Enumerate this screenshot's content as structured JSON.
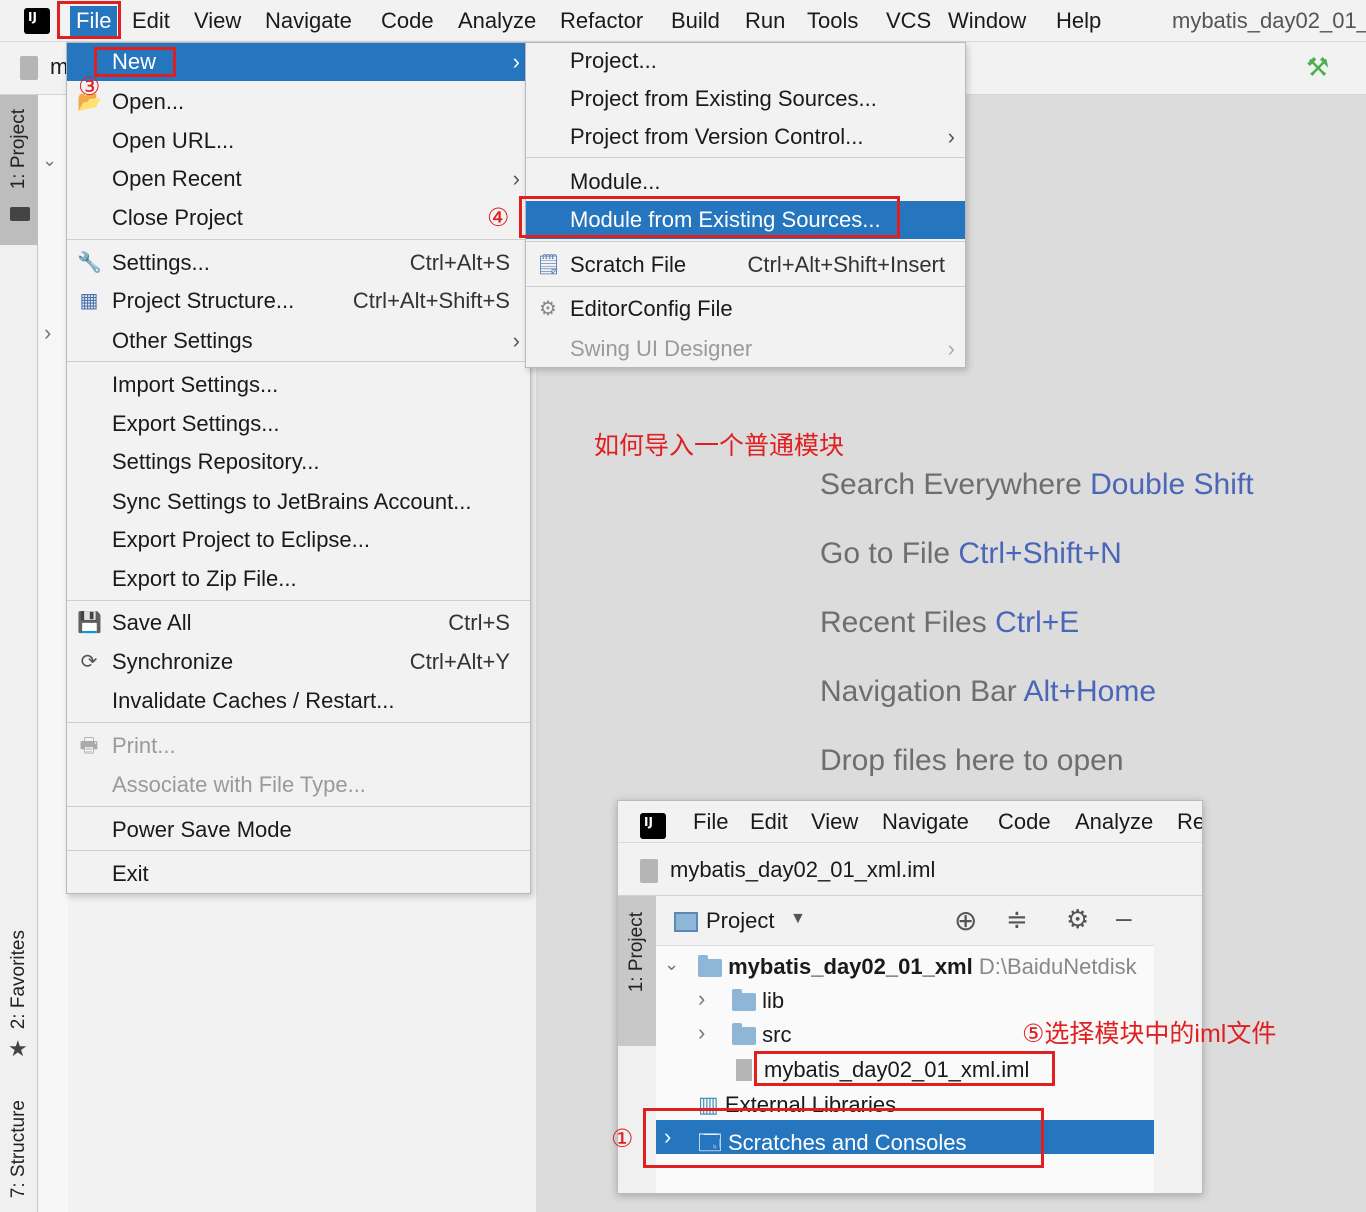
{
  "window": {
    "title": "mybatis_day02_01_"
  },
  "menubar": [
    {
      "label": "File"
    },
    {
      "label": "Edit"
    },
    {
      "label": "View"
    },
    {
      "label": "Navigate"
    },
    {
      "label": "Code"
    },
    {
      "label": "Analyze"
    },
    {
      "label": "Refactor"
    },
    {
      "label": "Build"
    },
    {
      "label": "Run"
    },
    {
      "label": "Tools"
    },
    {
      "label": "VCS"
    },
    {
      "label": "Window"
    },
    {
      "label": "Help"
    }
  ],
  "toolbar": {
    "project_crumb": "m"
  },
  "left_tabs": {
    "project": "1: Project",
    "favorites": "2: Favorites",
    "structure": "7: Structure"
  },
  "file_menu": {
    "items": [
      {
        "label": "New",
        "arrow": "›"
      },
      {
        "label": "Open..."
      },
      {
        "label": "Open URL..."
      },
      {
        "label": "Open Recent",
        "arrow": "›"
      },
      {
        "label": "Close Project"
      },
      {
        "label": "Settings...",
        "shortcut": "Ctrl+Alt+S",
        "icon": "wrench-icon"
      },
      {
        "label": "Project Structure...",
        "shortcut": "Ctrl+Alt+Shift+S",
        "icon": "project-structure-icon"
      },
      {
        "label": "Other Settings",
        "arrow": "›"
      },
      {
        "label": "Import Settings..."
      },
      {
        "label": "Export Settings..."
      },
      {
        "label": "Settings Repository..."
      },
      {
        "label": "Sync Settings to JetBrains Account..."
      },
      {
        "label": "Export Project to Eclipse..."
      },
      {
        "label": "Export to Zip File..."
      },
      {
        "label": "Save All",
        "shortcut": "Ctrl+S",
        "icon": "save-icon"
      },
      {
        "label": "Synchronize",
        "shortcut": "Ctrl+Alt+Y",
        "icon": "sync-icon"
      },
      {
        "label": "Invalidate Caches / Restart..."
      },
      {
        "label": "Print...",
        "icon": "print-icon"
      },
      {
        "label": "Associate with File Type..."
      },
      {
        "label": "Power Save Mode"
      },
      {
        "label": "Exit"
      }
    ]
  },
  "new_submenu": {
    "items": [
      {
        "label": "Project..."
      },
      {
        "label": "Project from Existing Sources..."
      },
      {
        "label": "Project from Version Control...",
        "arrow": "›"
      },
      {
        "label": "Module..."
      },
      {
        "label": "Module from Existing Sources..."
      },
      {
        "label": "Scratch File",
        "shortcut": "Ctrl+Alt+Shift+Insert",
        "icon": "scratch-file-icon"
      },
      {
        "label": "EditorConfig File",
        "icon": "gear-icon"
      },
      {
        "label": "Swing UI Designer",
        "arrow": "›"
      }
    ]
  },
  "annotations": {
    "step3": "③",
    "step4": "④",
    "step1": "①",
    "heading": "如何导入一个普通模块",
    "step5": "⑤选择模块中的iml文件"
  },
  "editor_hints": [
    {
      "text": "Search Everywhere",
      "key": "Double Shift"
    },
    {
      "text": "Go to File",
      "key": "Ctrl+Shift+N"
    },
    {
      "text": "Recent Files",
      "key": "Ctrl+E"
    },
    {
      "text": "Navigation Bar",
      "key": "Alt+Home"
    },
    {
      "text": "Drop files here to open",
      "key": ""
    }
  ],
  "inset": {
    "menubar": [
      "File",
      "Edit",
      "View",
      "Navigate",
      "Code",
      "Analyze",
      "Re"
    ],
    "crumb": "mybatis_day02_01_xml.iml",
    "side_tab": "1: Project",
    "panel_title": "Project",
    "tree": {
      "root_name": "mybatis_day02_01_xml",
      "root_path": "D:\\BaiduNetdisk",
      "lib": "lib",
      "src": "src",
      "iml": "mybatis_day02_01_xml.iml",
      "ext": "External Libraries",
      "scratches": "Scratches and Consoles"
    }
  },
  "colors": {
    "selection": "#2675bf",
    "annotation_red": "#e02020",
    "hint_key": "#4a66b8"
  }
}
